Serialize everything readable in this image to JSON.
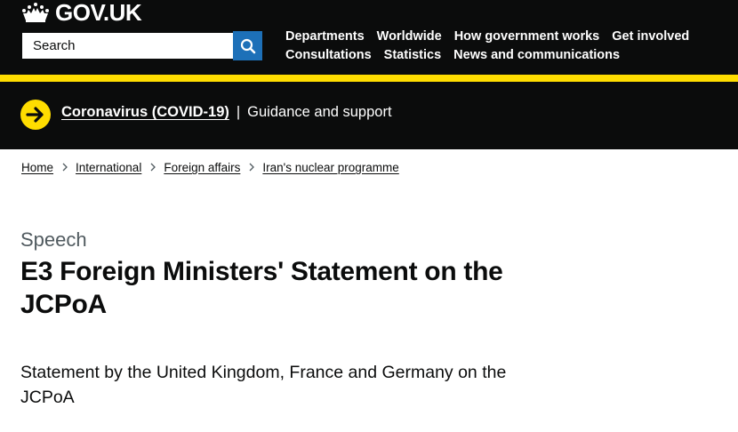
{
  "header": {
    "logo_text": "GOV.UK",
    "search": {
      "placeholder": "Search"
    },
    "nav": [
      {
        "label": "Departments"
      },
      {
        "label": "Worldwide"
      },
      {
        "label": "How government works"
      },
      {
        "label": "Get involved"
      },
      {
        "label": "Consultations"
      },
      {
        "label": "Statistics"
      },
      {
        "label": "News and communications"
      }
    ]
  },
  "banner": {
    "link": "Coronavirus (COVID-19)",
    "separator": "|",
    "text": "Guidance and support"
  },
  "breadcrumbs": [
    {
      "label": "Home"
    },
    {
      "label": "International"
    },
    {
      "label": "Foreign affairs"
    },
    {
      "label": "Iran's nuclear programme"
    }
  ],
  "main": {
    "doc_type": "Speech",
    "title": "E3 Foreign Ministers' Statement on the JCPoA",
    "lede": "Statement by the United Kingdom, France and Germany on the JCPoA"
  },
  "colors": {
    "header_bg": "#0b0c0c",
    "yellow": "#ffdd00",
    "search_button": "#1d70b8",
    "caption": "#505a5f"
  },
  "icons": {
    "logo": "crown-icon",
    "search": "search-icon",
    "banner": "arrow-right-icon",
    "breadcrumb_separator": "chevron-right-icon"
  }
}
